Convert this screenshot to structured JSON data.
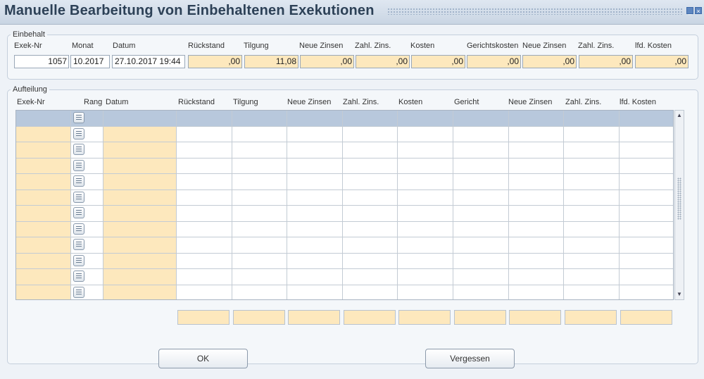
{
  "window": {
    "title": "Manuelle Bearbeitung von Einbehaltenen Exekutionen"
  },
  "einbehalt": {
    "legend": "Einbehalt",
    "labels": [
      "Exek-Nr",
      "Monat",
      "Datum",
      "Rückstand",
      "Tilgung",
      "Neue Zinsen",
      "Zahl. Zins.",
      "Kosten",
      "Gerichtskosten",
      "Neue Zinsen",
      "Zahl. Zins.",
      "lfd. Kosten"
    ],
    "values": [
      "1057",
      "10.2017",
      "27.10.2017 19:44",
      ",00",
      "11,08",
      ",00",
      ",00",
      ",00",
      ",00",
      ",00",
      ",00",
      ",00"
    ]
  },
  "aufteilung": {
    "legend": "Aufteilung",
    "columns": [
      "Exek-Nr",
      "Rang",
      "Datum",
      "Rückstand",
      "Tilgung",
      "Neue Zinsen",
      "Zahl. Zins.",
      "Kosten",
      "Gericht",
      "Neue Zinsen",
      "Zahl. Zins.",
      "lfd. Kosten"
    ],
    "row_count": 12,
    "selected_row": 1
  },
  "buttons": {
    "ok": "OK",
    "vergessen": "Vergessen"
  },
  "colors": {
    "required_field": "#fde8bd",
    "selected_row": "#b8c8dc",
    "title_text": "#2d4157"
  }
}
